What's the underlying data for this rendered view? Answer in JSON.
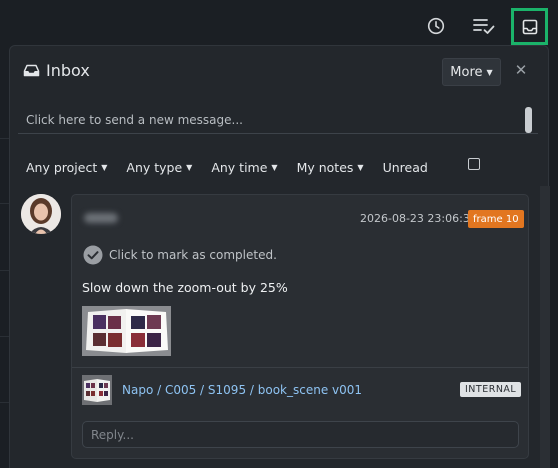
{
  "toolbar": {
    "icons": [
      "clock-icon",
      "checklist-icon",
      "inbox-tray-icon"
    ],
    "active_color": "#1bb36a"
  },
  "inbox": {
    "title": "Inbox",
    "more_label": "More",
    "close_symbol": "✕",
    "compose_placeholder": "Click here to send a new message...",
    "filters": {
      "project": "Any project",
      "type": "Any type",
      "time": "Any time",
      "notes": "My notes",
      "unread": "Unread"
    },
    "unread_checked": false
  },
  "message": {
    "timestamp": "2026-08-23 23:06:38",
    "frame_badge": "frame 10",
    "frame_badge_color": "#e27620",
    "mark_complete_label": "Click to mark as completed.",
    "body": "Slow down the zoom-out by 25%",
    "link_path": "Napo / C005 / S1095 / book_scene v001",
    "visibility_badge": "INTERNAL",
    "reply_placeholder": "Reply..."
  }
}
